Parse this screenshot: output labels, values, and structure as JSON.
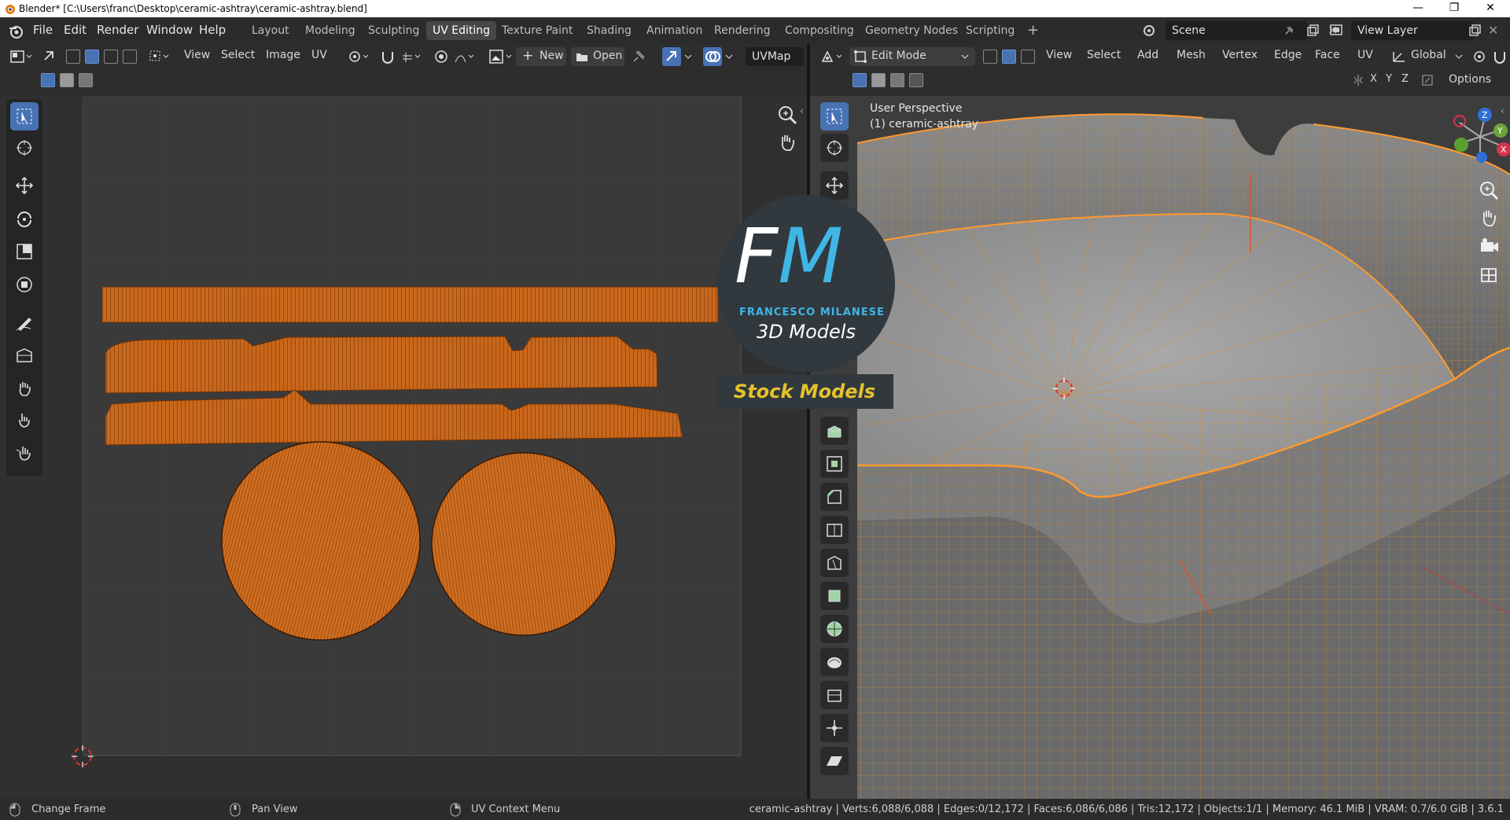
{
  "window": {
    "title": "Blender* [C:\\Users\\franc\\Desktop\\ceramic-ashtray\\ceramic-ashtray.blend]",
    "controls": [
      "—",
      "❐",
      "✕"
    ]
  },
  "menu": [
    "File",
    "Edit",
    "Render",
    "Window",
    "Help"
  ],
  "workspaces": {
    "tabs": [
      "Layout",
      "Modeling",
      "Sculpting",
      "UV Editing",
      "Texture Paint",
      "Shading",
      "Animation",
      "Rendering",
      "Compositing",
      "Geometry Nodes",
      "Scripting"
    ],
    "active": "UV Editing",
    "add": "+"
  },
  "scene": {
    "label": "Scene"
  },
  "view_layer": {
    "label": "View Layer"
  },
  "uv_editor": {
    "menus": [
      "View",
      "Select",
      "Image",
      "UV"
    ],
    "new_label": "New",
    "open_label": "Open",
    "uvmap": "UVMap"
  },
  "viewport": {
    "mode": "Edit Mode",
    "menus": [
      "View",
      "Select",
      "Add",
      "Mesh",
      "Vertex",
      "Edge",
      "Face",
      "UV"
    ],
    "orientation": "Global",
    "axes": [
      "X",
      "Y",
      "Z"
    ],
    "options": "Options",
    "overlay_line1": "User Perspective",
    "overlay_line2": "(1) ceramic-ashtray",
    "gizmo": {
      "z": "Z",
      "y": "Y",
      "x": "X"
    }
  },
  "watermark": {
    "logo_letters": "FM",
    "brand": "FRANCESCO MILANESE",
    "sub": "3D Models",
    "banner": "Stock Models"
  },
  "status": {
    "hint1": "Change Frame",
    "hint2": "Pan View",
    "hint3": "UV Context Menu",
    "stats": "ceramic-ashtray | Verts:6,088/6,088 | Edges:0/12,172 | Faces:6,086/6,086 | Tris:12,172 | Objects:1/1 | Memory: 46.1 MiB | VRAM: 0.7/6.0 GiB | 3.6.1"
  },
  "colors": {
    "accent": "#4772b3",
    "uv_orange": "#e07820",
    "edit_orange": "#ff9a2e",
    "banner_yellow": "#e6c22a"
  }
}
